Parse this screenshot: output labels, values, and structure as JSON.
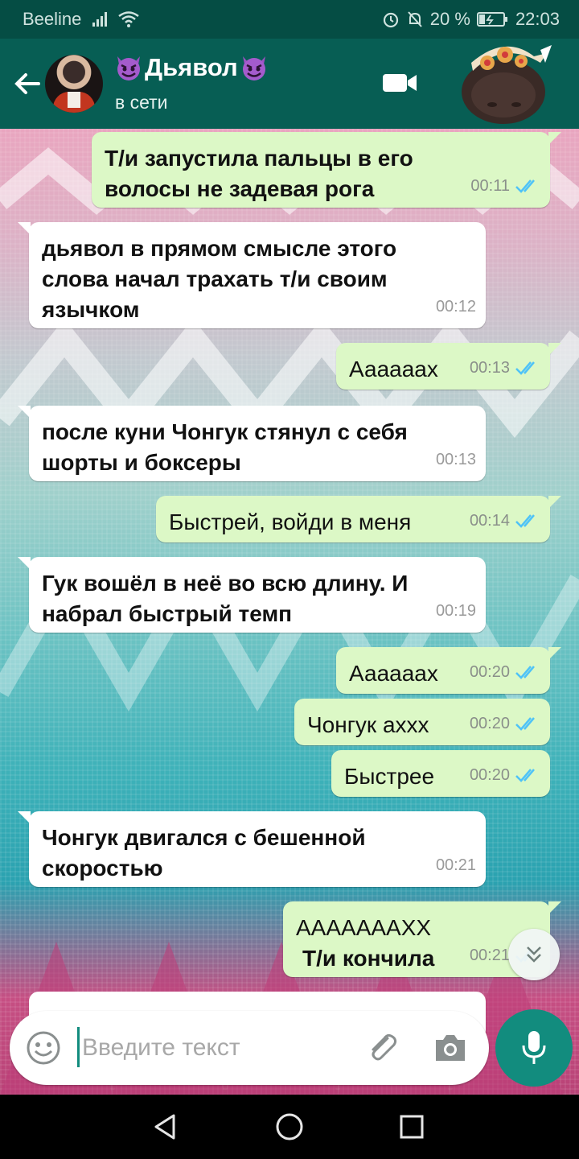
{
  "status_bar": {
    "carrier": "Beeline",
    "battery": "20 %",
    "time": "22:03"
  },
  "header": {
    "contact_name": "Дьявол",
    "contact_status": "в сети"
  },
  "messages": [
    {
      "dir": "out",
      "text": "Т/и запустила пальцы в его волосы не задевая рога",
      "time": "00:11",
      "read": true
    },
    {
      "dir": "in",
      "text": "дьявол в прямом смысле этого слова начал трахать т/и своим язычком",
      "time": "00:12"
    },
    {
      "dir": "out",
      "text": "Аааааах",
      "time": "00:13",
      "read": true
    },
    {
      "dir": "in",
      "text": "после куни Чонгук стянул с себя шорты и боксеры",
      "time": "00:13"
    },
    {
      "dir": "out",
      "text": "Быстрей, войди в меня",
      "time": "00:14",
      "read": true
    },
    {
      "dir": "in",
      "text": "Гук вошёл в неё во всю длину. И набрал быстрый темп",
      "time": "00:19"
    },
    {
      "dir": "out",
      "text": "Аааааах",
      "time": "00:20",
      "read": true
    },
    {
      "dir": "out",
      "text": "Чонгук ахxx",
      "time": "00:20",
      "read": true
    },
    {
      "dir": "out",
      "text": "Быстрее",
      "time": "00:20",
      "read": true
    },
    {
      "dir": "in",
      "text": "Чонгук двигался с бешенной скоростью",
      "time": "00:21"
    },
    {
      "dir": "out",
      "text_line1": "АААААААХХ",
      "text_line2": "Т/и кончила",
      "time": "00:21",
      "read": true
    }
  ],
  "composer": {
    "placeholder": "Введите текст"
  },
  "colors": {
    "header": "#075e54",
    "status_bar": "#054d44",
    "bubble_out": "#dcf8c6",
    "bubble_in": "#ffffff",
    "read_ticks": "#4fc3f7",
    "accent": "#128c7e"
  }
}
